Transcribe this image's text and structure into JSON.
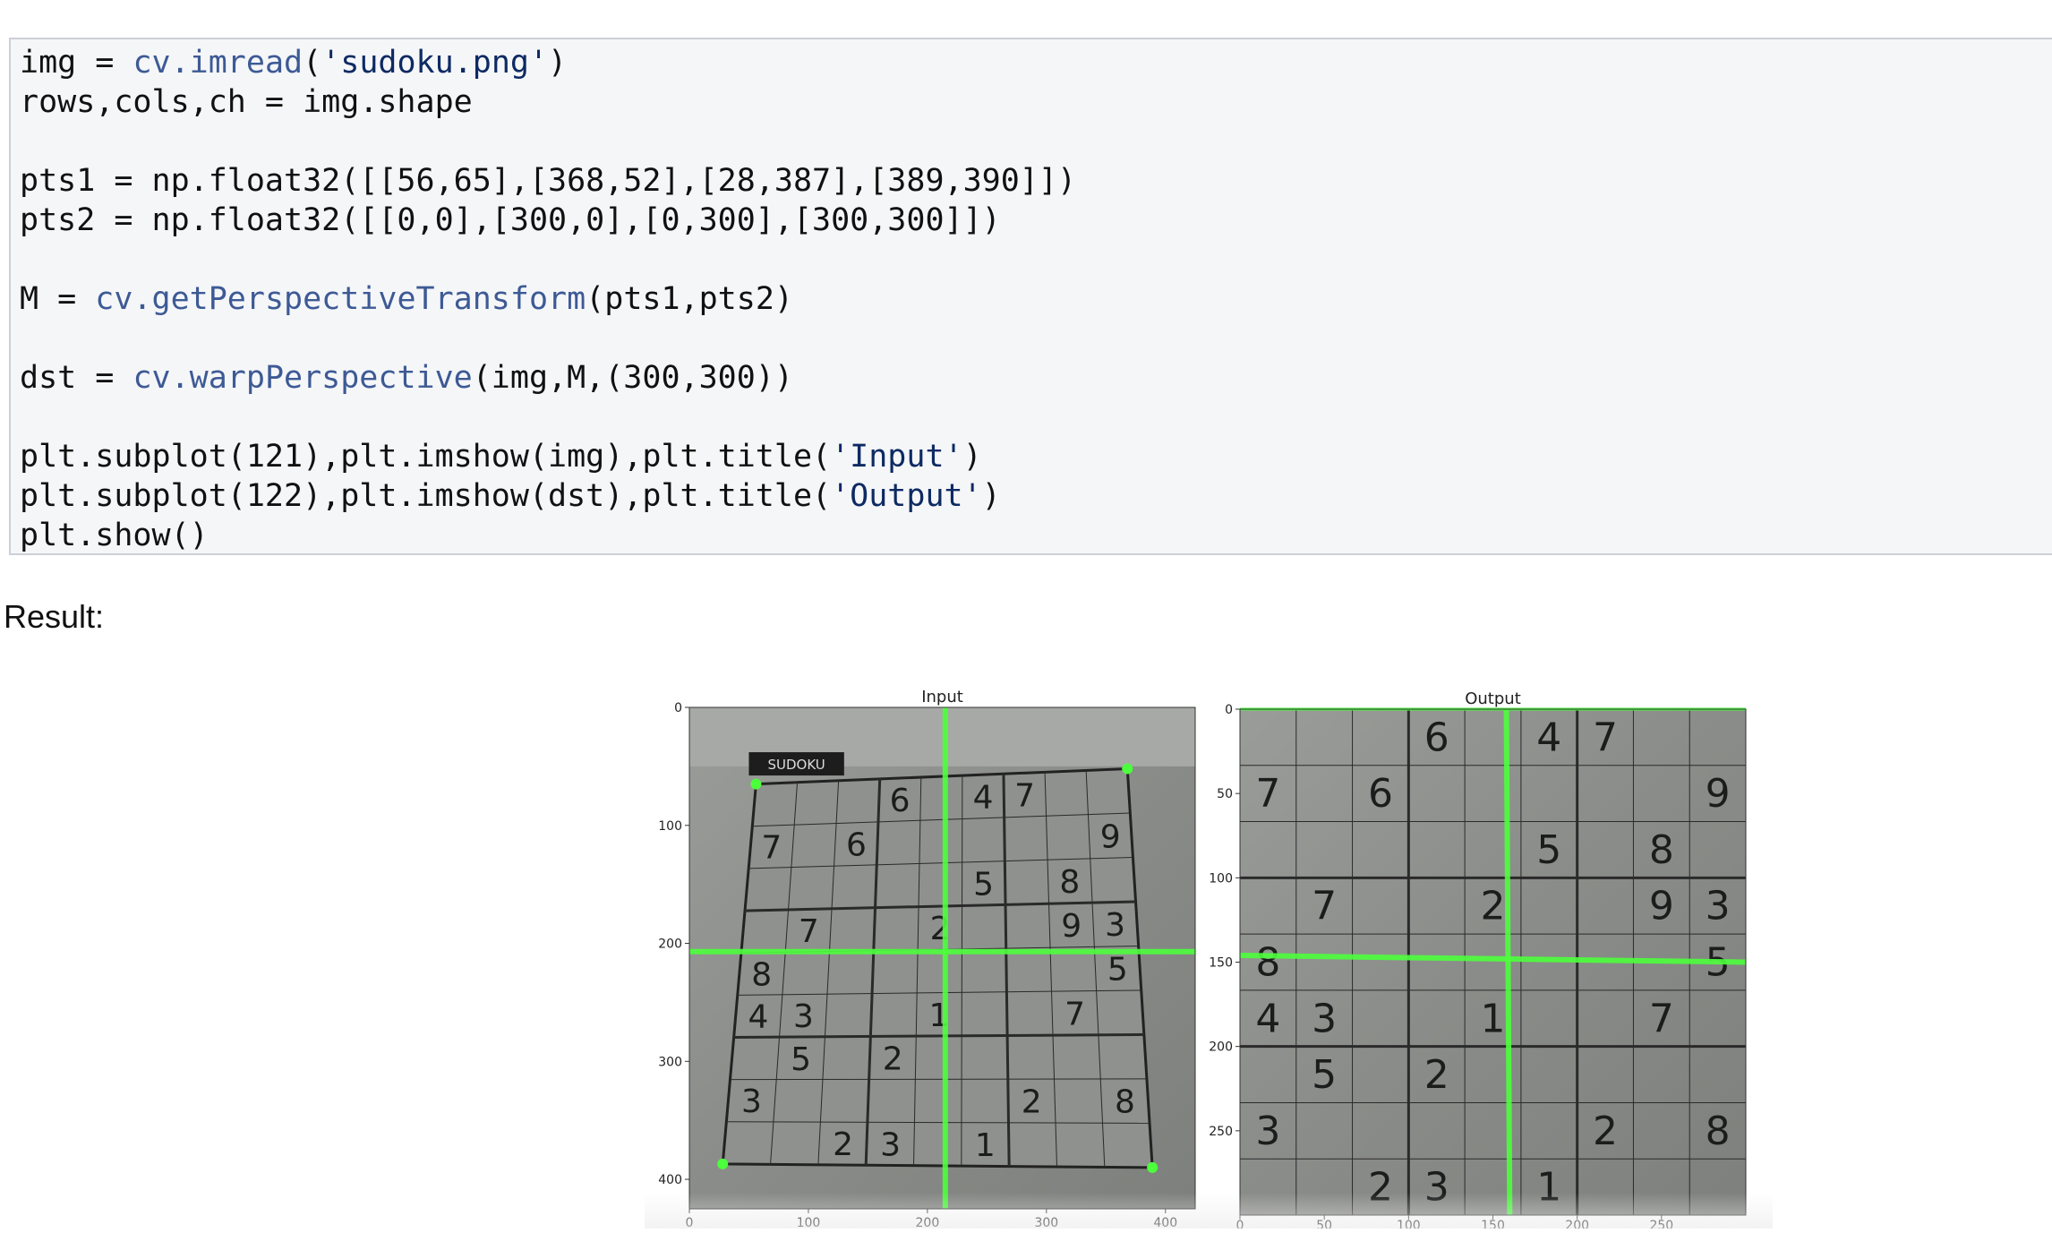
{
  "code": {
    "lines": [
      {
        "parts": [
          {
            "t": "img = ",
            "c": ""
          },
          {
            "t": "cv.imread",
            "c": "fn"
          },
          {
            "t": "(",
            "c": ""
          },
          {
            "t": "'sudoku.png'",
            "c": "str"
          },
          {
            "t": ")",
            "c": ""
          }
        ]
      },
      {
        "parts": [
          {
            "t": "rows,cols,ch = img.shape",
            "c": ""
          }
        ]
      },
      {
        "parts": []
      },
      {
        "parts": [
          {
            "t": "pts1 = np.float32([[56,65],[368,52],[28,387],[389,390]])",
            "c": ""
          }
        ]
      },
      {
        "parts": [
          {
            "t": "pts2 = np.float32([[0,0],[300,0],[0,300],[300,300]])",
            "c": ""
          }
        ]
      },
      {
        "parts": []
      },
      {
        "parts": [
          {
            "t": "M = ",
            "c": ""
          },
          {
            "t": "cv.getPerspectiveTransform",
            "c": "fn"
          },
          {
            "t": "(pts1,pts2)",
            "c": ""
          }
        ]
      },
      {
        "parts": []
      },
      {
        "parts": [
          {
            "t": "dst = ",
            "c": ""
          },
          {
            "t": "cv.warpPerspective",
            "c": "fn"
          },
          {
            "t": "(img,M,(300,300))",
            "c": ""
          }
        ]
      },
      {
        "parts": []
      },
      {
        "parts": [
          {
            "t": "plt.subplot(121),plt.imshow(img),plt.title(",
            "c": ""
          },
          {
            "t": "'Input'",
            "c": "str"
          },
          {
            "t": ")",
            "c": ""
          }
        ]
      },
      {
        "parts": [
          {
            "t": "plt.subplot(122),plt.imshow(dst),plt.title(",
            "c": ""
          },
          {
            "t": "'Output'",
            "c": "str"
          },
          {
            "t": ")",
            "c": ""
          }
        ]
      },
      {
        "parts": [
          {
            "t": "plt.show()",
            "c": ""
          }
        ]
      }
    ]
  },
  "result_label": "Result:",
  "colors": {
    "keyword_fn": "#3d5a95",
    "string": "#0d2a63",
    "highlight_green": "#4cff3c",
    "board": "#8c8f8c"
  },
  "plots": [
    {
      "title": "Input",
      "yticks": [
        "0",
        "100",
        "200",
        "300",
        "400"
      ],
      "xticks": [
        "0",
        "100",
        "200",
        "300",
        "400"
      ],
      "header_text": "SUDOKU",
      "corner_points": [
        [
          56,
          65
        ],
        [
          368,
          52
        ],
        [
          28,
          387
        ],
        [
          389,
          390
        ]
      ],
      "digits": [
        {
          "v": "6",
          "r": 0,
          "c": 3
        },
        {
          "v": "4",
          "r": 0,
          "c": 5
        },
        {
          "v": "7",
          "r": 0,
          "c": 6
        },
        {
          "v": "7",
          "r": 1,
          "c": 0
        },
        {
          "v": "6",
          "r": 1,
          "c": 2
        },
        {
          "v": "9",
          "r": 1,
          "c": 8
        },
        {
          "v": "5",
          "r": 2,
          "c": 5
        },
        {
          "v": "8",
          "r": 2,
          "c": 7
        },
        {
          "v": "7",
          "r": 3,
          "c": 1
        },
        {
          "v": "2",
          "r": 3,
          "c": 4
        },
        {
          "v": "9",
          "r": 3,
          "c": 7
        },
        {
          "v": "3",
          "r": 3,
          "c": 8
        },
        {
          "v": "8",
          "r": 4,
          "c": 0
        },
        {
          "v": "5",
          "r": 4,
          "c": 8
        },
        {
          "v": "4",
          "r": 5,
          "c": 0
        },
        {
          "v": "3",
          "r": 5,
          "c": 1
        },
        {
          "v": "1",
          "r": 5,
          "c": 4
        },
        {
          "v": "7",
          "r": 5,
          "c": 7
        },
        {
          "v": "5",
          "r": 6,
          "c": 1
        },
        {
          "v": "2",
          "r": 6,
          "c": 3
        },
        {
          "v": "3",
          "r": 7,
          "c": 0
        },
        {
          "v": "2",
          "r": 7,
          "c": 6
        },
        {
          "v": "8",
          "r": 7,
          "c": 8
        },
        {
          "v": "2",
          "r": 8,
          "c": 2
        },
        {
          "v": "3",
          "r": 8,
          "c": 3
        },
        {
          "v": "1",
          "r": 8,
          "c": 5
        }
      ]
    },
    {
      "title": "Output",
      "yticks": [
        "0",
        "50",
        "100",
        "150",
        "200",
        "250"
      ],
      "xticks": [
        "0",
        "50",
        "100",
        "150",
        "200",
        "250"
      ],
      "digits": [
        {
          "v": "6",
          "r": 0,
          "c": 3
        },
        {
          "v": "4",
          "r": 0,
          "c": 5
        },
        {
          "v": "7",
          "r": 0,
          "c": 6
        },
        {
          "v": "7",
          "r": 1,
          "c": 0
        },
        {
          "v": "6",
          "r": 1,
          "c": 2
        },
        {
          "v": "9",
          "r": 1,
          "c": 8
        },
        {
          "v": "5",
          "r": 2,
          "c": 5
        },
        {
          "v": "8",
          "r": 2,
          "c": 7
        },
        {
          "v": "7",
          "r": 3,
          "c": 1
        },
        {
          "v": "2",
          "r": 3,
          "c": 4
        },
        {
          "v": "9",
          "r": 3,
          "c": 7
        },
        {
          "v": "3",
          "r": 3,
          "c": 8
        },
        {
          "v": "8",
          "r": 4,
          "c": 0
        },
        {
          "v": "5",
          "r": 4,
          "c": 8
        },
        {
          "v": "4",
          "r": 5,
          "c": 0
        },
        {
          "v": "3",
          "r": 5,
          "c": 1
        },
        {
          "v": "1",
          "r": 5,
          "c": 4
        },
        {
          "v": "7",
          "r": 5,
          "c": 7
        },
        {
          "v": "5",
          "r": 6,
          "c": 1
        },
        {
          "v": "2",
          "r": 6,
          "c": 3
        },
        {
          "v": "3",
          "r": 7,
          "c": 0
        },
        {
          "v": "2",
          "r": 7,
          "c": 6
        },
        {
          "v": "8",
          "r": 7,
          "c": 8
        },
        {
          "v": "2",
          "r": 8,
          "c": 2
        },
        {
          "v": "3",
          "r": 8,
          "c": 3
        },
        {
          "v": "1",
          "r": 8,
          "c": 5
        }
      ]
    }
  ]
}
